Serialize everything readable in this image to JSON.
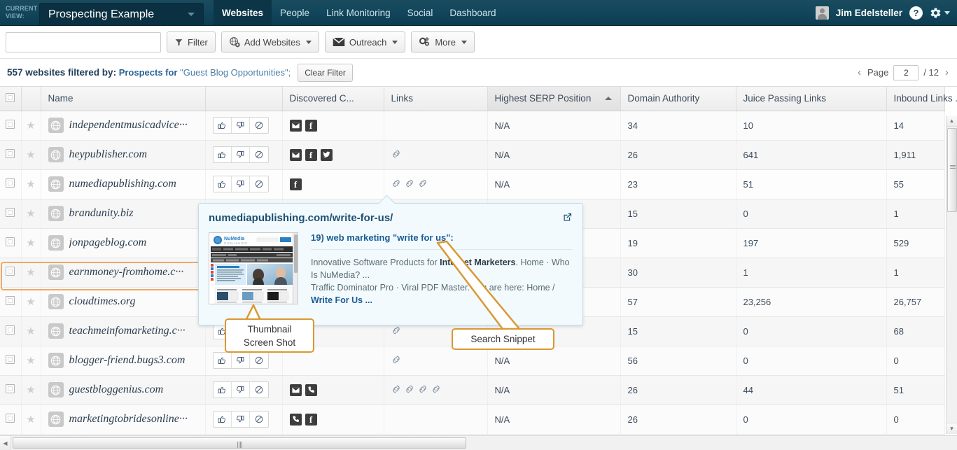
{
  "header": {
    "current_view_label": "CURRENT VIEW:",
    "view_name": "Prospecting Example",
    "tabs": [
      {
        "label": "Websites",
        "active": true
      },
      {
        "label": "People",
        "active": false
      },
      {
        "label": "Link Monitoring",
        "active": false
      },
      {
        "label": "Social",
        "active": false
      },
      {
        "label": "Dashboard",
        "active": false
      }
    ],
    "user_name": "Jim Edelsteller",
    "help_label": "?",
    "icons": {
      "avatar": "avatar-icon",
      "help": "help-icon",
      "gear": "gear-icon"
    },
    "accent_bg": "#12475c"
  },
  "toolbar": {
    "search_value": "",
    "search_placeholder": "",
    "filter_label": "Filter",
    "add_websites_label": "Add Websites",
    "outreach_label": "Outreach",
    "more_label": "More"
  },
  "filterbar": {
    "count_text": "557 websites filtered by:",
    "filter_link": "Prospects for",
    "filter_query": "\"Guest Blog Opportunities\";",
    "clear_label": "Clear Filter",
    "page_label": "Page",
    "page_value": "2",
    "page_total": "/ 12",
    "prev_arrow": "‹",
    "next_arrow": "›"
  },
  "table": {
    "columns": [
      {
        "key": "check",
        "label": ""
      },
      {
        "key": "star",
        "label": ""
      },
      {
        "key": "name",
        "label": "Name"
      },
      {
        "key": "rate",
        "label": ""
      },
      {
        "key": "discovered",
        "label": "Discovered C..."
      },
      {
        "key": "links",
        "label": "Links"
      },
      {
        "key": "serp",
        "label": "Highest SERP Position",
        "sorted": true
      },
      {
        "key": "da",
        "label": "Domain Authority"
      },
      {
        "key": "jpl",
        "label": "Juice Passing Links"
      },
      {
        "key": "ibl",
        "label": "Inbound Links ."
      }
    ],
    "rows": [
      {
        "name": "independentmusicadvice···",
        "contacts": [
          "mail",
          "facebook"
        ],
        "links": 0,
        "serp": "N/A",
        "da": "34",
        "jpl": "10",
        "ibl": "14",
        "highlight": false
      },
      {
        "name": "heypublisher.com",
        "contacts": [
          "mail",
          "facebook",
          "twitter"
        ],
        "links": 1,
        "serp": "N/A",
        "da": "26",
        "jpl": "641",
        "ibl": "1,911",
        "highlight": false
      },
      {
        "name": "numediapublishing.com",
        "contacts": [
          "facebook"
        ],
        "links": 3,
        "serp": "N/A",
        "da": "23",
        "jpl": "51",
        "ibl": "55",
        "highlight": true
      },
      {
        "name": "brandunity.biz",
        "contacts": [],
        "links": 0,
        "serp": "",
        "da": "15",
        "jpl": "0",
        "ibl": "1",
        "highlight": false
      },
      {
        "name": "jonpageblog.com",
        "contacts": [],
        "links": 0,
        "serp": "",
        "da": "19",
        "jpl": "197",
        "ibl": "529",
        "highlight": false
      },
      {
        "name": "earnmoney-fromhome.c···",
        "contacts": [],
        "links": 0,
        "serp": "",
        "da": "30",
        "jpl": "1",
        "ibl": "1",
        "highlight": false
      },
      {
        "name": "cloudtimes.org",
        "contacts": [],
        "links": 0,
        "serp": "",
        "da": "57",
        "jpl": "23,256",
        "ibl": "26,757",
        "highlight": false
      },
      {
        "name": "teachmeinfomarketing.c···",
        "contacts": [],
        "links": 1,
        "serp": "",
        "da": "15",
        "jpl": "0",
        "ibl": "68",
        "highlight": false
      },
      {
        "name": "blogger-friend.bugs3.com",
        "contacts": [],
        "links": 1,
        "serp": "N/A",
        "da": "56",
        "jpl": "0",
        "ibl": "0",
        "highlight": false
      },
      {
        "name": "guestbloggenius.com",
        "contacts": [
          "mail",
          "phone"
        ],
        "links": 4,
        "serp": "N/A",
        "da": "26",
        "jpl": "44",
        "ibl": "51",
        "highlight": false
      },
      {
        "name": "marketingtobridesonline···",
        "contacts": [
          "phone",
          "facebook"
        ],
        "links": 0,
        "serp": "N/A",
        "da": "26",
        "jpl": "0",
        "ibl": "0",
        "highlight": false
      }
    ]
  },
  "popup": {
    "url": "numediapublishing.com/write-for-us/",
    "open_external_icon": "external-link-icon",
    "snippet_title": "19) web marketing \"write for us\":",
    "snippet_line1_a": "Innovative Software Products for ",
    "snippet_line1_b": "Internet Marketers",
    "snippet_line1_c": ". Home · Who Is NuMedia? ...",
    "snippet_line2_a": "Traffic Dominator Pro · Viral PDF Master. You are here: Home / ",
    "snippet_line2_b": "Write For Us ...",
    "thumbnail": {
      "brand_main": "NuMedia",
      "brand_sub": "PUBLISHING"
    }
  },
  "callouts": [
    {
      "id": "thumbnail",
      "text": "Thumbnail\nScreen Shot",
      "line1": "Thumbnail",
      "line2": "Screen Shot"
    },
    {
      "id": "snippet",
      "text": "Search Snippet",
      "line1": "Search Snippet",
      "line2": ""
    }
  ],
  "colors": {
    "nav_dark": "#12475c",
    "callout_border": "#d99833",
    "highlight_border": "#f0a868",
    "popup_bg": "#f2fafd",
    "link_blue": "#1a5c96"
  }
}
